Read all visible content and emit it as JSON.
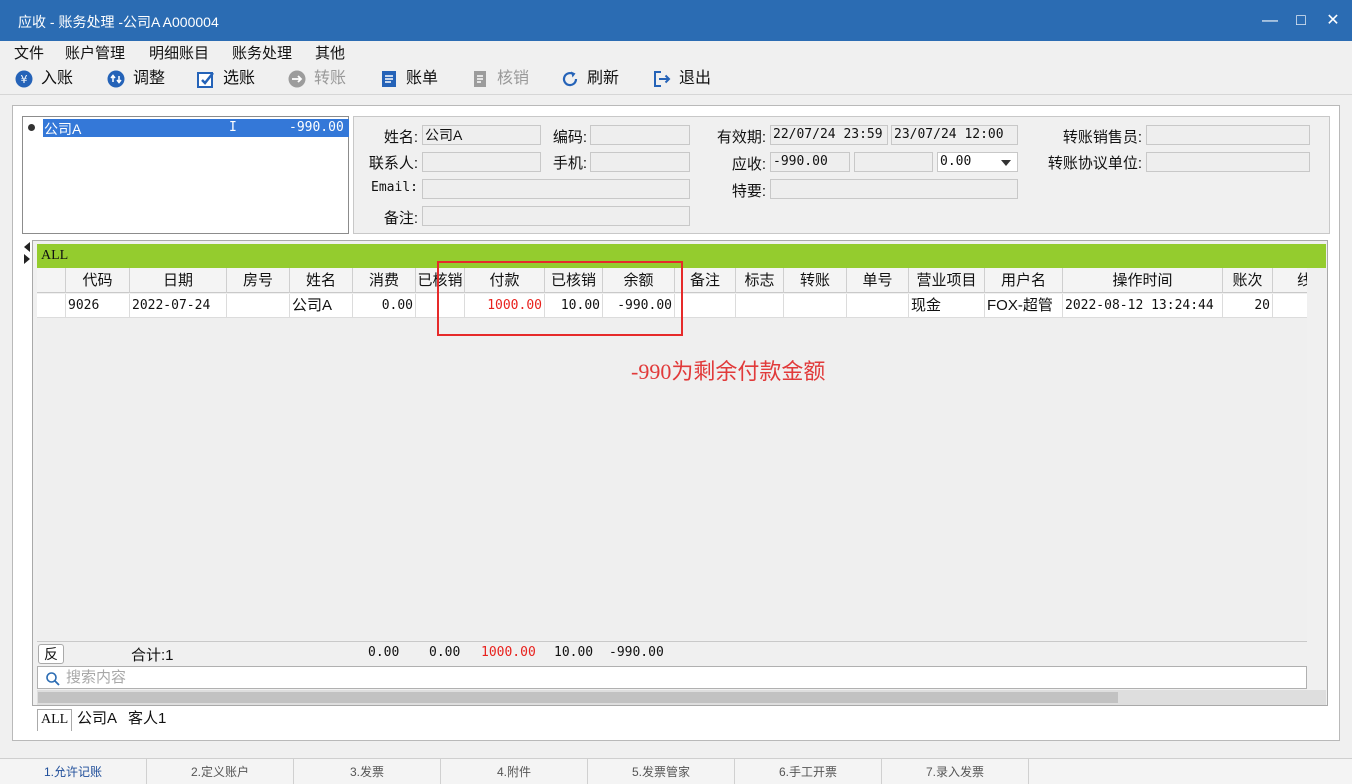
{
  "window": {
    "title": "应收 - 账务处理 -公司A  A000004"
  },
  "menu": [
    "文件",
    "账户管理",
    "明细账目",
    "账务处理",
    "其他"
  ],
  "toolbar": [
    {
      "label": "入账",
      "icon": "yen-circle-icon",
      "enabled": true
    },
    {
      "label": "调整",
      "icon": "adjust-arrows-icon",
      "enabled": true
    },
    {
      "label": "选账",
      "icon": "select-check-icon",
      "enabled": true
    },
    {
      "label": "转账",
      "icon": "transfer-arrow-icon",
      "enabled": false
    },
    {
      "label": "账单",
      "icon": "bill-document-icon",
      "enabled": true
    },
    {
      "label": "核销",
      "icon": "writeoff-document-icon",
      "enabled": false
    },
    {
      "label": "刷新",
      "icon": "refresh-icon",
      "enabled": true
    },
    {
      "label": "退出",
      "icon": "exit-icon",
      "enabled": true
    }
  ],
  "account_list": [
    {
      "name": "公司A",
      "flag": "I",
      "balance": "-990.00"
    }
  ],
  "info": {
    "name_label": "姓名:",
    "name": "公司A",
    "code_label": "编码:",
    "code": "",
    "contact_label": "联系人:",
    "contact": "",
    "mobile_label": "手机:",
    "mobile": "",
    "email_label": "Email:",
    "email": "",
    "note_label": "备注:",
    "note": "",
    "validity_label": "有效期:",
    "valid_from": "22/07/24 23:59",
    "valid_to": "23/07/24 12:00",
    "receivable_label": "应收:",
    "receivable": "-990.00",
    "receivable_extra": "",
    "receivable_select": "0.00",
    "special_label": "特要:",
    "special": "",
    "transfer_sales_label": "转账销售员:",
    "transfer_sales": "",
    "transfer_unit_label": "转账协议单位:",
    "transfer_unit": ""
  },
  "grid": {
    "group": "ALL",
    "columns": [
      "代码",
      "日期",
      "房号",
      "姓名",
      "消费",
      "已核销",
      "付款",
      "已核销",
      "余额",
      "备注",
      "标志",
      "转账",
      "单号",
      "营业项目",
      "用户名",
      "操作时间",
      "账次",
      "线"
    ],
    "rows": [
      [
        "9026",
        "2022-07-24",
        "",
        "公司A",
        "0.00",
        "",
        "1000.00",
        "10.00",
        "-990.00",
        "",
        "",
        "",
        "",
        "现金",
        "FOX-超管",
        "2022-08-12 13:24:44",
        "20",
        ""
      ]
    ],
    "totals": {
      "reverse_label": "反",
      "count_label": "合计:1",
      "consumption": "0.00",
      "written_off": "0.00",
      "payment": "1000.00",
      "payment_written_off": "10.00",
      "balance": "-990.00"
    },
    "search_placeholder": "搜索内容"
  },
  "annotation": {
    "text": "-990为剩余付款金额",
    "color": "#e13a3a"
  },
  "sub_tabs": [
    "ALL",
    "公司A",
    "客人1"
  ],
  "bottom_tabs": [
    "1.允许记账",
    "2.定义账户",
    "3.发票",
    "4.附件",
    "5.发票管家",
    "6.手工开票",
    "7.录入发票"
  ],
  "colors": {
    "titlebar": "#2b6cb3",
    "group_bar": "#94cc2e",
    "selection": "#3478d8",
    "payment_text": "#e8221e"
  }
}
